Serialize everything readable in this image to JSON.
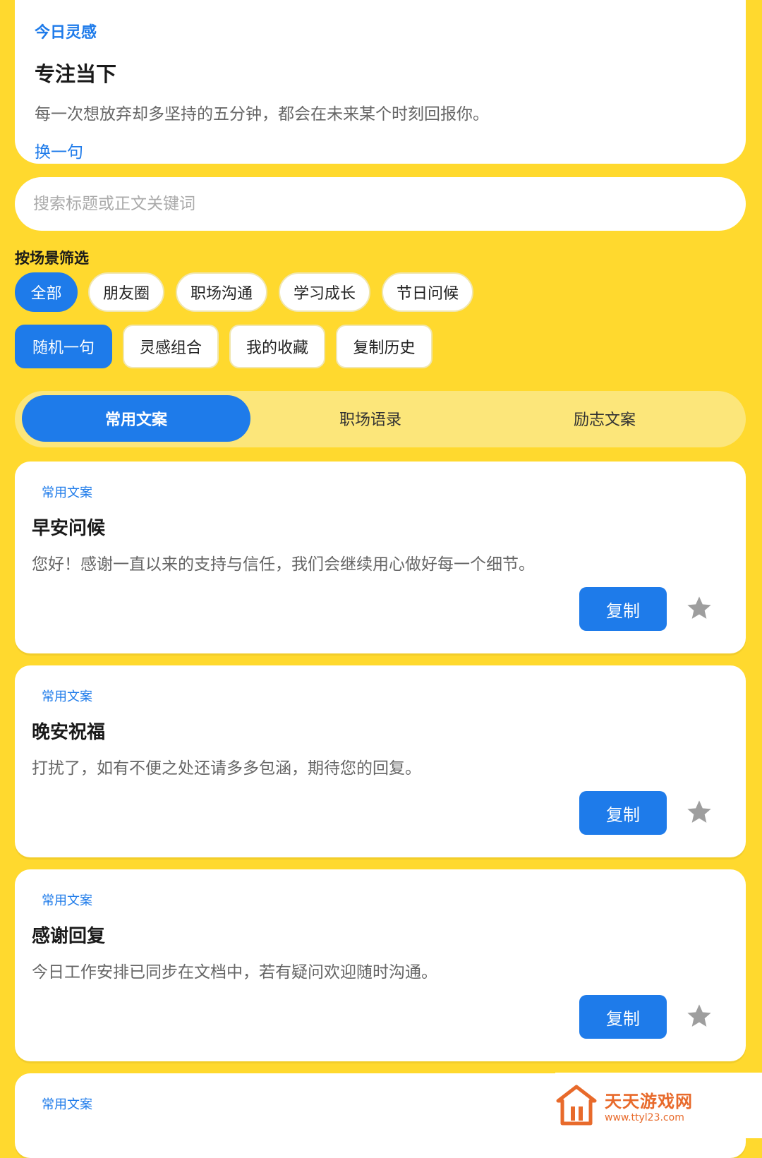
{
  "inspiration": {
    "eyebrow": "今日灵感",
    "title": "专注当下",
    "text": "每一次想放弃却多坚持的五分钟，都会在未来某个时刻回报你。",
    "refresh_label": "换一句"
  },
  "search": {
    "placeholder": "搜索标题或正文关键词"
  },
  "filter": {
    "label": "按场景筛选",
    "scenes": [
      "全部",
      "朋友圈",
      "职场沟通",
      "学习成长",
      "节日问候"
    ],
    "tools": [
      "随机一句",
      "灵感组合",
      "我的收藏",
      "复制历史"
    ]
  },
  "tabs": [
    "常用文案",
    "职场语录",
    "励志文案"
  ],
  "items": [
    {
      "tag": "常用文案",
      "title": "早安问候",
      "text": "您好！感谢一直以来的支持与信任，我们会继续用心做好每一个细节。",
      "copy_label": "复制"
    },
    {
      "tag": "常用文案",
      "title": "晚安祝福",
      "text": "打扰了，如有不便之处还请多多包涵，期待您的回复。",
      "copy_label": "复制"
    },
    {
      "tag": "常用文案",
      "title": "感谢回复",
      "text": "今日工作安排已同步在文档中，若有疑问欢迎随时沟通。",
      "copy_label": "复制"
    },
    {
      "tag": "常用文案"
    }
  ],
  "watermark": {
    "name": "天天游戏网",
    "url": "www.ttyl23.com"
  },
  "colors": {
    "accent": "#1E7BEA",
    "background": "#FFD92E",
    "star": "#9E9E9E"
  }
}
